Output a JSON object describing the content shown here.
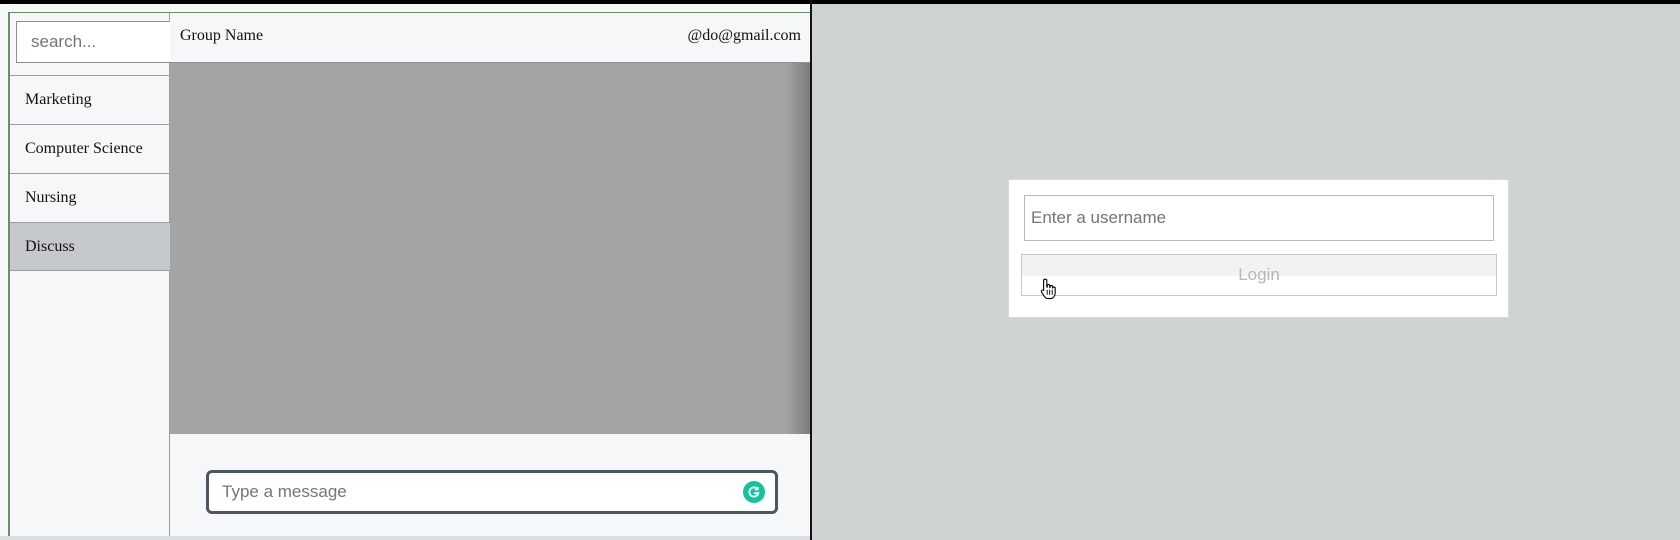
{
  "chat_app": {
    "search": {
      "placeholder": "search..."
    },
    "groups": [
      {
        "label": "Marketing",
        "active": false
      },
      {
        "label": "Computer Science",
        "active": false
      },
      {
        "label": "Nursing",
        "active": false
      },
      {
        "label": "Discuss",
        "active": true
      }
    ],
    "header": {
      "group_name": "Group Name",
      "user_email": "@do@gmail.com"
    },
    "composer": {
      "placeholder": "Type a message",
      "assistant_icon": "grammarly-icon"
    }
  },
  "login": {
    "username": {
      "placeholder": "Enter a username",
      "value": ""
    },
    "login_label": "Login"
  },
  "cursor": {
    "icon": "hand-pointer-icon"
  },
  "colors": {
    "sidebar_bg": "#f5f7f9",
    "active_group_bg": "#c6c9cb",
    "messages_bg": "#a3a4a3",
    "right_pane_bg": "#cfd2d3",
    "grammarly_green": "#15c39a",
    "frame_green": "#6a8f67"
  }
}
